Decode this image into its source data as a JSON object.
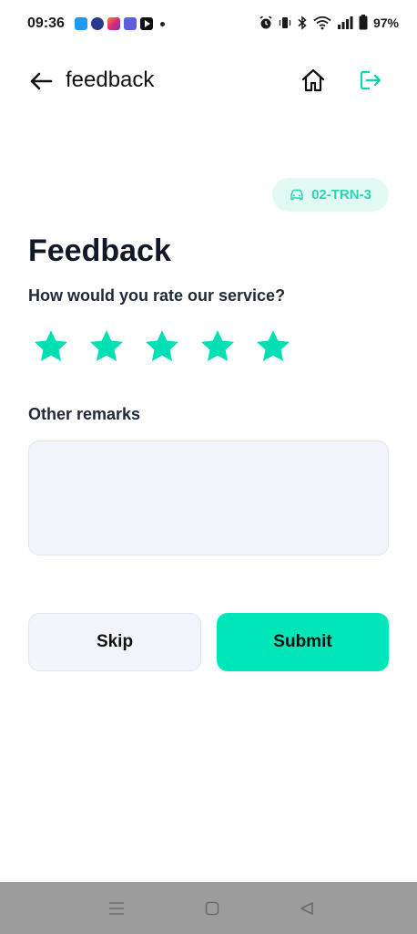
{
  "status_bar": {
    "time": "09:36",
    "battery": "97%"
  },
  "header": {
    "title": "feedback"
  },
  "vehicle": {
    "plate": "02-TRN-3"
  },
  "page": {
    "title": "Feedback",
    "rating_question": "How would you rate our service?",
    "rating": {
      "value": 5,
      "max": 5
    },
    "remarks_label": "Other remarks",
    "remarks_value": ""
  },
  "actions": {
    "skip_label": "Skip",
    "submit_label": "Submit"
  },
  "colors": {
    "accent": "#00E6B8",
    "chip_bg": "#E3FAF4",
    "input_bg": "#F4F5FA"
  }
}
